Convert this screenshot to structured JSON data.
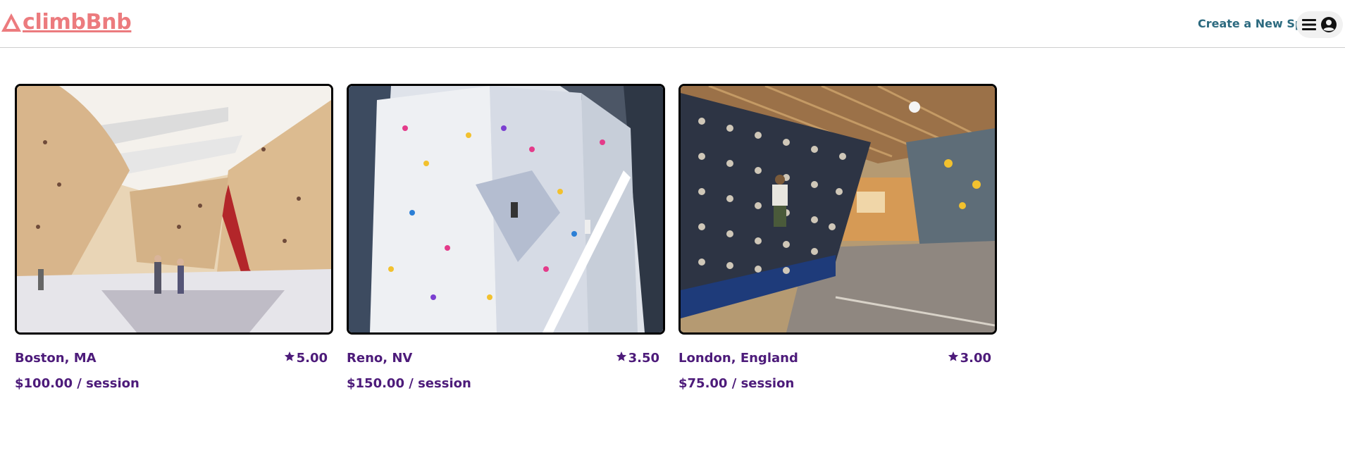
{
  "header": {
    "logo_text": "climbBnb",
    "create_spot_label": "Create a New Spot",
    "brand_color": "#ec7b7e",
    "accent_color": "#4d1b7a",
    "link_color": "#2c6a7f"
  },
  "icons": {
    "logo": "mountain-icon",
    "menu": "hamburger-menu-icon",
    "user": "user-circle-icon",
    "rating": "star-icon"
  },
  "spots": [
    {
      "city": "Boston, MA",
      "rating": "5.00",
      "price": "$100.00 / session"
    },
    {
      "city": "Reno, NV",
      "rating": "3.50",
      "price": "$150.00 / session"
    },
    {
      "city": "London, England",
      "rating": "3.00",
      "price": "$75.00 / session"
    }
  ]
}
